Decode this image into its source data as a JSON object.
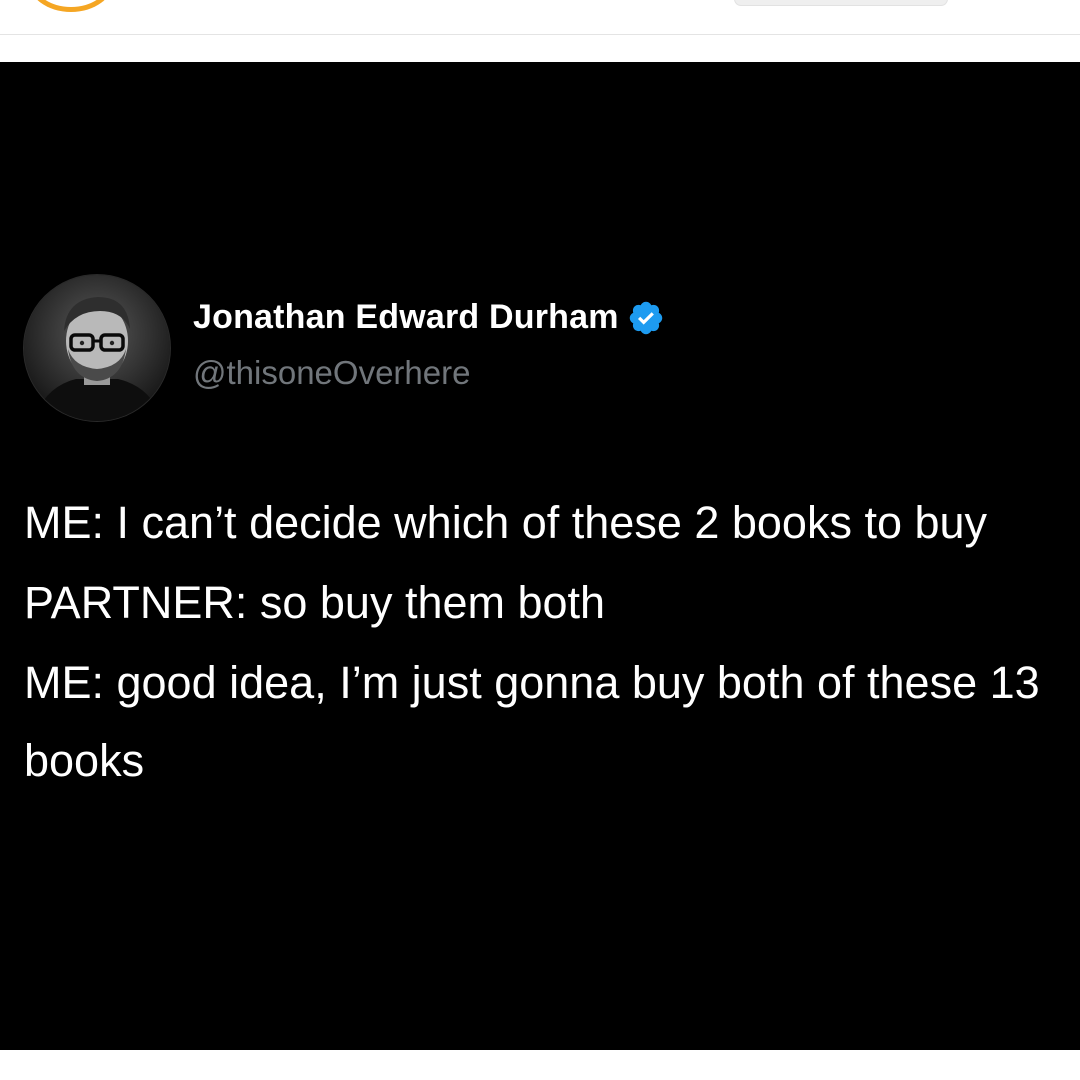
{
  "tweet": {
    "author_name": "Jonathan Edward Durham",
    "handle": "@thisoneOverhere",
    "verified_color": "#1d9bf0",
    "paragraphs": [
      "ME: I can’t decide which of these 2 books to buy",
      "PARTNER: so buy them both",
      "ME: good idea, I’m just gonna buy both of these 13 books"
    ]
  },
  "colors": {
    "tweet_background": "#000000",
    "handle_text": "#71767b",
    "logo_accent": "#f5a623"
  }
}
